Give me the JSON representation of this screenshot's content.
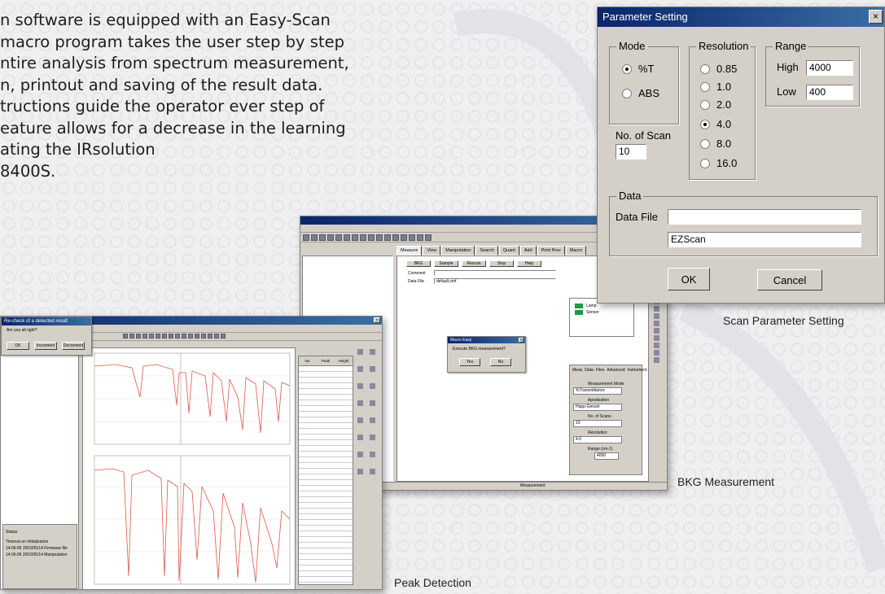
{
  "intro": {
    "lines": [
      "n software is equipped with an Easy-Scan",
      " macro program takes the user step by step",
      "ntire analysis from spectrum measurement,",
      "n, printout and saving of the result data.",
      "tructions guide the operator ever step of",
      "eature allows for a decrease in the learning",
      "ating the IRsolution",
      "8400S."
    ]
  },
  "captions": {
    "scan_param": "Scan Parameter Setting",
    "bkg": "BKG Measurement",
    "peak": "Peak Detection"
  },
  "param_dialog": {
    "title": "Parameter Setting",
    "close": "×",
    "mode": {
      "label": "Mode",
      "options": [
        {
          "label": "%T",
          "selected": true
        },
        {
          "label": "ABS",
          "selected": false
        }
      ]
    },
    "resolution": {
      "label": "Resolution",
      "options": [
        {
          "label": "0.85",
          "selected": false
        },
        {
          "label": "1.0",
          "selected": false
        },
        {
          "label": "2.0",
          "selected": false
        },
        {
          "label": "4.0",
          "selected": true
        },
        {
          "label": "8.0",
          "selected": false
        },
        {
          "label": "16.0",
          "selected": false
        }
      ]
    },
    "range": {
      "label": "Range",
      "high_label": "High",
      "high_value": "4000",
      "low_label": "Low",
      "low_value": "400"
    },
    "scans": {
      "label": "No. of Scan",
      "value": "10"
    },
    "data": {
      "label": "Data",
      "file_label": "Data File",
      "file_value": "",
      "comment_value": "EZScan"
    },
    "ok_label": "OK",
    "cancel_label": "Cancel"
  },
  "bkg_window": {
    "tabs": [
      "Measure",
      "View",
      "Manipulation",
      "Search",
      "Quant",
      "Add",
      "Print Prev",
      "Macro"
    ],
    "buttons": [
      "BKG",
      "Sample",
      "Rescan",
      "Stop",
      "Help"
    ],
    "fields": {
      "comment": "Comment",
      "data_file": "Data File",
      "data_file_value": "default.smf"
    },
    "legend": [
      "Lamp",
      "Sensor"
    ],
    "dialog": {
      "title": "Macro Easy",
      "question": "Execute BKG measurement?",
      "yes": "Yes",
      "no": "No"
    },
    "panel_tabs": [
      "Meas",
      "Data",
      "Files",
      "Advanced",
      "Instrument"
    ],
    "panel_rows": [
      {
        "label": "Measurement Mode",
        "value": "%Transmittance"
      },
      {
        "label": "Apodization",
        "value": "Happ-Genzel"
      },
      {
        "label": "No. of Scans",
        "value": "10"
      },
      {
        "label": "Resolution",
        "value": "4.0"
      },
      {
        "label": "Range (cm-1)",
        "value": "4000"
      }
    ],
    "status": "Measurement"
  },
  "peak_window": {
    "dialog": {
      "title": "Re-check of a detected result",
      "question": "Are you all right?",
      "buttons": [
        "OK",
        "Increment",
        "Decrement"
      ]
    },
    "status_label": "Status",
    "status_lines": [
      "Timeout on Initialization",
      "14:06:06 2002/05/14 Firmware file",
      "14:06:06 2002/05/14 Manipulation"
    ],
    "table_headers": [
      "No.",
      "Peak",
      "Height"
    ]
  }
}
